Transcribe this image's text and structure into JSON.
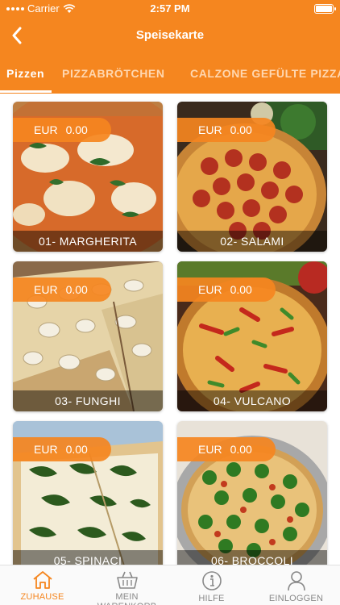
{
  "status_bar": {
    "carrier": "Carrier",
    "time": "2:57 PM"
  },
  "nav": {
    "title": "Speisekarte",
    "back_icon": "chevron-left-icon"
  },
  "tabs": [
    {
      "label": "Pizzen",
      "active": true
    },
    {
      "label": "PIZZABRÖTCHEN",
      "active": false
    },
    {
      "label": "CALZONE GEFÜLTE PIZZA",
      "active": false
    }
  ],
  "products": [
    {
      "name": "01- MARGHERITA",
      "currency": "EUR",
      "price": "0.00"
    },
    {
      "name": "02- SALAMI",
      "currency": "EUR",
      "price": "0.00"
    },
    {
      "name": "03- FUNGHI",
      "currency": "EUR",
      "price": "0.00"
    },
    {
      "name": "04- VULCANO",
      "currency": "EUR",
      "price": "0.00"
    },
    {
      "name": "05- SPINACI",
      "currency": "EUR",
      "price": "0.00"
    },
    {
      "name": "06- BROCCOLI",
      "currency": "EUR",
      "price": "0.00"
    }
  ],
  "tab_bar": [
    {
      "label": "ZUHAUSE",
      "icon": "home-icon",
      "active": true
    },
    {
      "label": "MEIN WARENKORB",
      "icon": "basket-icon",
      "active": false
    },
    {
      "label": "HILFE",
      "icon": "info-icon",
      "active": false
    },
    {
      "label": "EINLOGGEN",
      "icon": "user-icon",
      "active": false
    }
  ],
  "colors": {
    "accent": "#f5861f",
    "inactive": "#888888"
  }
}
